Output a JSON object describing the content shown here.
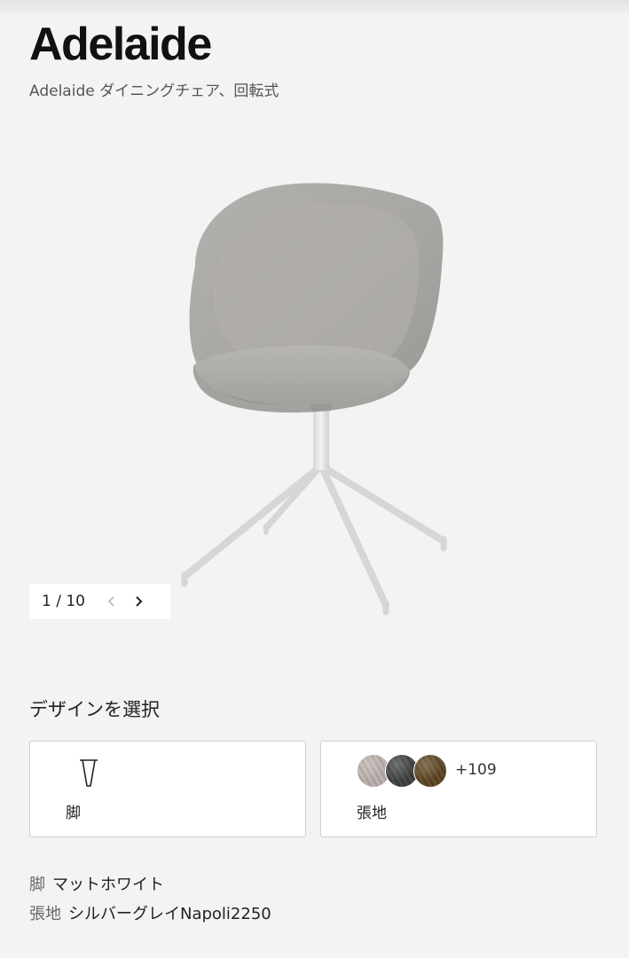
{
  "product": {
    "title": "Adelaide",
    "subtitle": "Adelaide ダイニングチェア、回転式"
  },
  "gallery": {
    "counter": "1 / 10",
    "image_alt": "Adelaide chair",
    "prev_icon": "chevron-left-icon",
    "next_icon": "chevron-right-icon",
    "prev_enabled": false,
    "next_enabled": true
  },
  "design": {
    "heading": "デザインを選択",
    "legs_card": {
      "label": "脚",
      "icon": "leg-icon"
    },
    "fabric_card": {
      "label": "張地",
      "more_count": "+109",
      "swatches": [
        {
          "name": "light-fabric-swatch",
          "color": "#b9aeaa"
        },
        {
          "name": "dark-fabric-swatch",
          "color": "#3d3f3e"
        },
        {
          "name": "brown-fabric-swatch",
          "color": "#5b4320"
        }
      ]
    }
  },
  "specs": {
    "legs": {
      "key": "脚",
      "value": "マットホワイト"
    },
    "fabric": {
      "key": "張地",
      "value": "シルバーグレイNapoli2250"
    }
  },
  "colors": {
    "background": "#f3f3f3",
    "card_border": "#cfcfcf",
    "chair_fabric": "#a9a7a4",
    "chair_base": "#e6e6e6"
  }
}
